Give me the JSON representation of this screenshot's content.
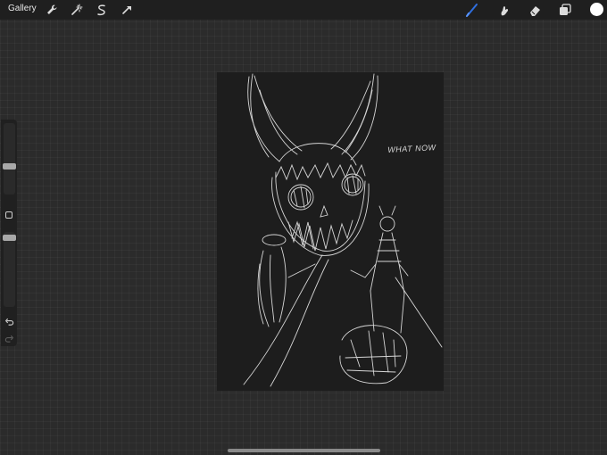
{
  "topbar": {
    "gallery_label": "Gallery",
    "left_tools": [
      "wrench-icon",
      "magic-wand-icon",
      "selection-icon",
      "transform-arrow-icon"
    ],
    "right_tools": [
      "brush-icon",
      "smudge-icon",
      "eraser-icon",
      "layers-icon"
    ],
    "active_tool": "brush-icon",
    "accent_color": "#2f6fe0",
    "current_color": "#ffffff"
  },
  "sidebar": {
    "brush_size_level": 0.66,
    "opacity_level": 0.95,
    "icons": [
      "modify-square-icon",
      "undo-icon",
      "redo-icon"
    ]
  },
  "canvas": {
    "background": "#1d1d1d",
    "handwritten_text": "WHAT NOW"
  }
}
